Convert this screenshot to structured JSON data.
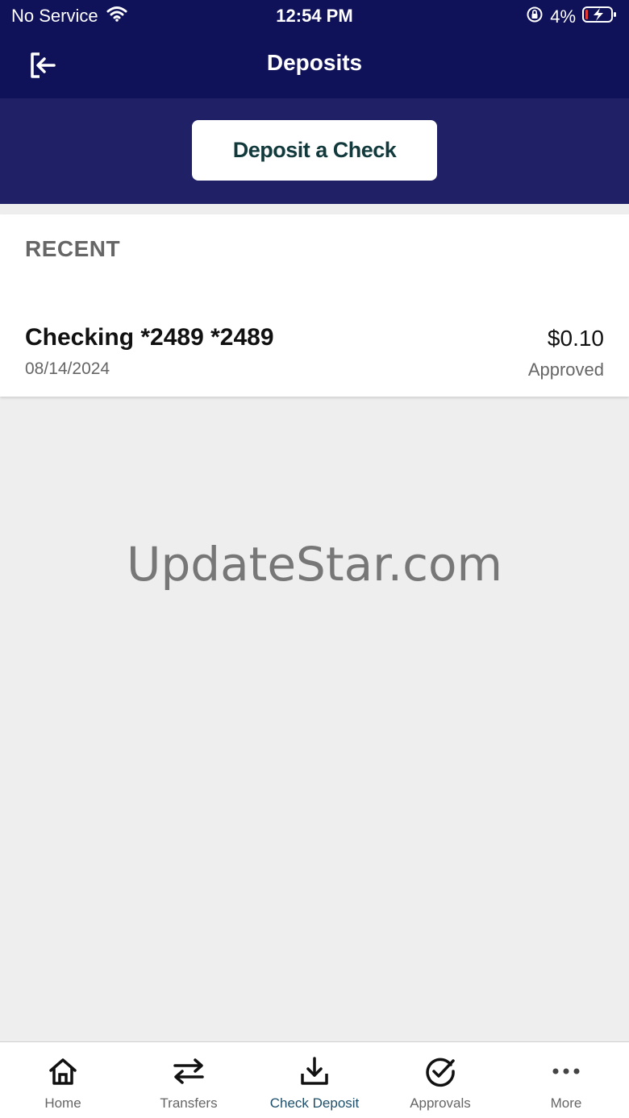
{
  "status_bar": {
    "carrier": "No Service",
    "time": "12:54 PM",
    "battery": "4%"
  },
  "header": {
    "title": "Deposits"
  },
  "actions": {
    "deposit_label": "Deposit a Check"
  },
  "recent": {
    "label": "RECENT",
    "items": [
      {
        "account": "Checking *2489 *2489",
        "date": "08/14/2024",
        "amount": "$0.10",
        "status": "Approved"
      }
    ]
  },
  "watermark": "UpdateStar.com",
  "nav": {
    "items": [
      {
        "label": "Home",
        "icon": "home-icon"
      },
      {
        "label": "Transfers",
        "icon": "transfer-arrows-icon"
      },
      {
        "label": "Check Deposit",
        "icon": "download-tray-icon",
        "active": true
      },
      {
        "label": "Approvals",
        "icon": "check-circle-icon"
      },
      {
        "label": "More",
        "icon": "more-dots-icon"
      }
    ]
  },
  "colors": {
    "header_bg": "#0f1159",
    "band_bg": "#1f2066",
    "active_nav": "#1d4f6b"
  }
}
